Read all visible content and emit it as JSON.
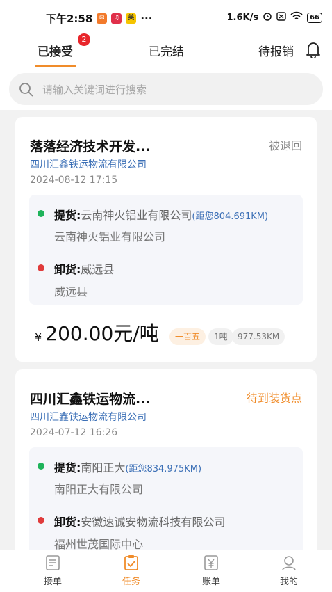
{
  "status_bar": {
    "time": "下午2:58",
    "dots": "···",
    "net_speed": "1.6K/s",
    "battery": "66"
  },
  "tabs": {
    "accepted": "已接受",
    "accepted_badge": "2",
    "completed": "已完结",
    "pending": "待报销"
  },
  "search": {
    "placeholder": "请输入关键词进行搜索"
  },
  "orders": [
    {
      "title": "落落经济技术开发...",
      "status": "被退回",
      "status_color": "#888888",
      "company": "四川汇鑫铁运物流有限公司",
      "date": "2024-08-12 17:15",
      "pickup_label": "提货:",
      "pickup_name": "云南神火铝业有限公司",
      "pickup_distance": "(距您804.691KM)",
      "pickup_sub": "云南神火铝业有限公司",
      "unload_label": "卸货:",
      "unload_name": "威远县",
      "unload_sub": "威远县",
      "currency": "¥",
      "price": "200.00元/吨",
      "tags": [
        "一百五",
        "1吨",
        "977.53KM"
      ]
    },
    {
      "title": "四川汇鑫铁运物流...",
      "status": "待到装货点",
      "status_color": "#f08c2a",
      "company": "四川汇鑫铁运物流有限公司",
      "date": "2024-07-12 16:26",
      "pickup_label": "提货:",
      "pickup_name": "南阳正大",
      "pickup_distance": "(距您834.975KM)",
      "pickup_sub": "南阳正大有限公司",
      "unload_label": "卸货:",
      "unload_name": "安徽速诚安物流科技有限公司",
      "unload_sub": "福州世茂国际中心"
    }
  ],
  "bottom_nav": {
    "receive": "接单",
    "tasks": "任务",
    "bills": "账单",
    "mine": "我的"
  },
  "colors": {
    "accent": "#f08c2a",
    "link": "#3b6fb6",
    "pickup_dot": "#1fb35a",
    "unload_dot": "#e03b3b",
    "badge": "#e8262b"
  }
}
